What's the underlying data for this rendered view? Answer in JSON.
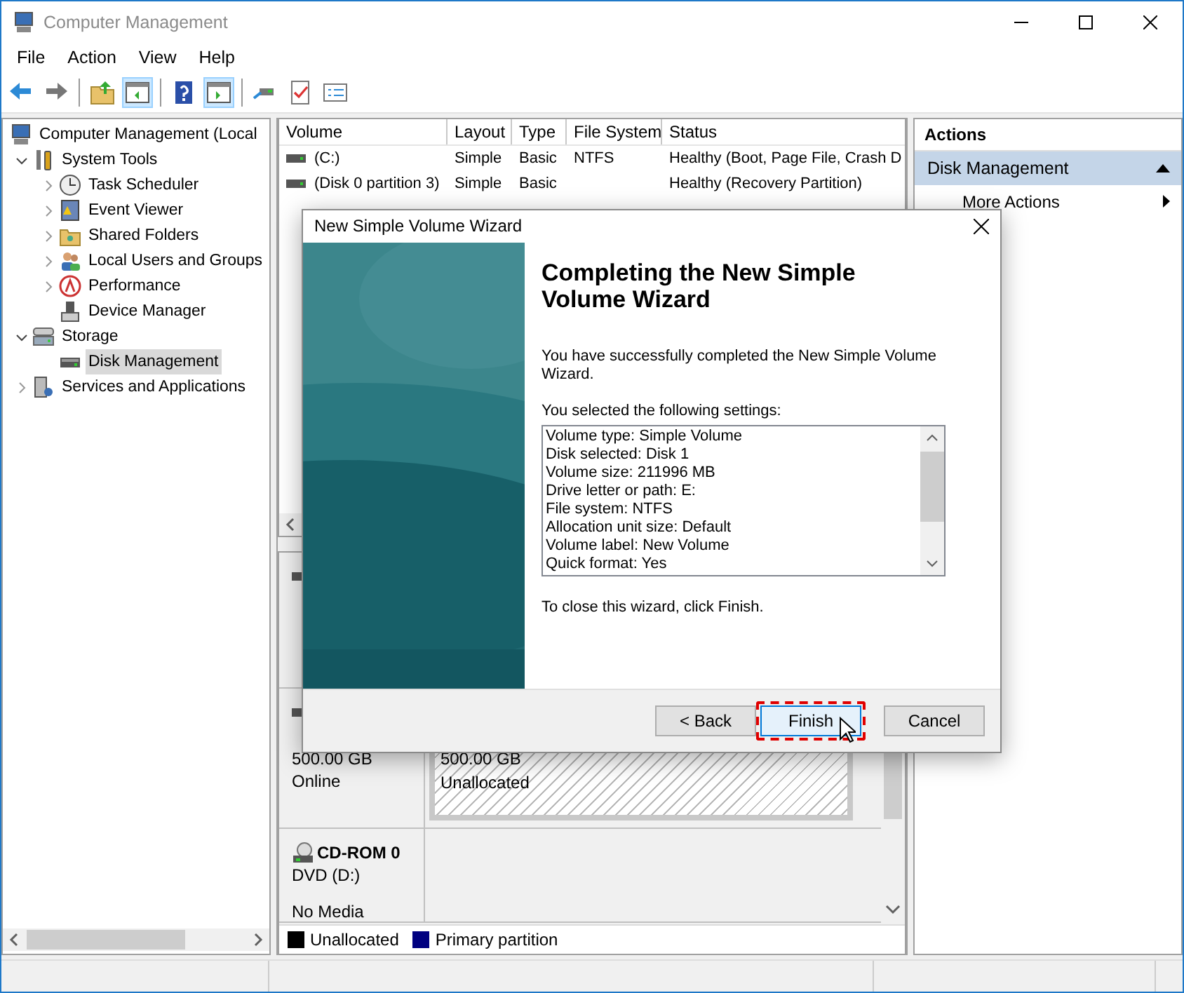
{
  "window": {
    "title": "Computer Management"
  },
  "menu": [
    "File",
    "Action",
    "View",
    "Help"
  ],
  "toolbar": [
    {
      "kind": "back",
      "on": false
    },
    {
      "kind": "forward",
      "on": false
    },
    {
      "kind": "sep"
    },
    {
      "kind": "up",
      "on": false
    },
    {
      "kind": "pane-left",
      "on": true
    },
    {
      "kind": "sep"
    },
    {
      "kind": "help",
      "on": false
    },
    {
      "kind": "pane-right",
      "on": true
    },
    {
      "kind": "sep"
    },
    {
      "kind": "connect",
      "on": false
    },
    {
      "kind": "check",
      "on": false
    },
    {
      "kind": "list",
      "on": false
    }
  ],
  "tree": [
    {
      "label": "Computer Management (Local",
      "kind": "computer",
      "selected": false,
      "children": [
        {
          "label": "System Tools",
          "kind": "tools",
          "expanded": true,
          "selected": false,
          "children": [
            {
              "label": "Task Scheduler",
              "kind": "clock",
              "expanded": false,
              "selected": false
            },
            {
              "label": "Event Viewer",
              "kind": "event",
              "expanded": false,
              "selected": false
            },
            {
              "label": "Shared Folders",
              "kind": "folder",
              "expanded": false,
              "selected": false
            },
            {
              "label": "Local Users and Groups",
              "kind": "users",
              "expanded": false,
              "selected": false
            },
            {
              "label": "Performance",
              "kind": "performance",
              "expanded": false,
              "selected": false
            },
            {
              "label": "Device Manager",
              "kind": "device",
              "selected": false
            }
          ]
        },
        {
          "label": "Storage",
          "kind": "storage",
          "expanded": true,
          "selected": false,
          "children": [
            {
              "label": "Disk Management",
              "kind": "disk",
              "selected": true
            }
          ]
        },
        {
          "label": "Services and Applications",
          "kind": "services",
          "expanded": false,
          "selected": false
        }
      ]
    }
  ],
  "volumes": {
    "columns": [
      "Volume",
      "Layout",
      "Type",
      "File System",
      "Status"
    ],
    "rows": [
      {
        "volume": "(C:)",
        "layout": "Simple",
        "type": "Basic",
        "file_system": "NTFS",
        "status": "Healthy (Boot, Page File, Crash D"
      },
      {
        "volume": "(Disk 0 partition 3)",
        "layout": "Simple",
        "type": "Basic",
        "status": "Healthy (Recovery Partition)"
      }
    ]
  },
  "disks": [
    {
      "kind": "disk"
    },
    {
      "kind": "disk",
      "lines": [
        "500.00 GB",
        "Online"
      ],
      "partitions": [
        {
          "kind": "unallocated",
          "lines": [
            "500.00 GB",
            "Unallocated"
          ]
        }
      ]
    },
    {
      "kind": "cdrom",
      "name": "CD-ROM 0",
      "lines": [
        "DVD (D:)",
        "No Media"
      ]
    }
  ],
  "legend": [
    {
      "label": "Unallocated",
      "color": "#000000"
    },
    {
      "label": "Primary partition",
      "color": "#000080"
    }
  ],
  "actions": {
    "title": "Actions",
    "sections": [
      {
        "label": "Disk Management",
        "expanded": true,
        "items": [
          "More Actions"
        ]
      }
    ]
  },
  "dialog": {
    "title": "New Simple Volume Wizard",
    "heading": "Completing the New Simple Volume Wizard",
    "intro": "You have successfully completed the New Simple Volume Wizard.",
    "settings_label": "You selected the following settings:",
    "settings": [
      "Volume type: Simple Volume",
      "Disk selected: Disk 1",
      "Volume size: 211996 MB",
      "Drive letter or path: E:",
      "File system: NTFS",
      "Allocation unit size: Default",
      "Volume label: New Volume",
      "Quick format: Yes"
    ],
    "closing": "To close this wizard, click Finish.",
    "buttons": [
      {
        "label": "< Back",
        "default": false,
        "annotated": false,
        "hovered": false
      },
      {
        "label": "Finish",
        "default": true,
        "annotated": true,
        "hovered": true
      },
      {
        "label": "Cancel",
        "default": false,
        "annotated": false,
        "hovered": false
      }
    ]
  }
}
